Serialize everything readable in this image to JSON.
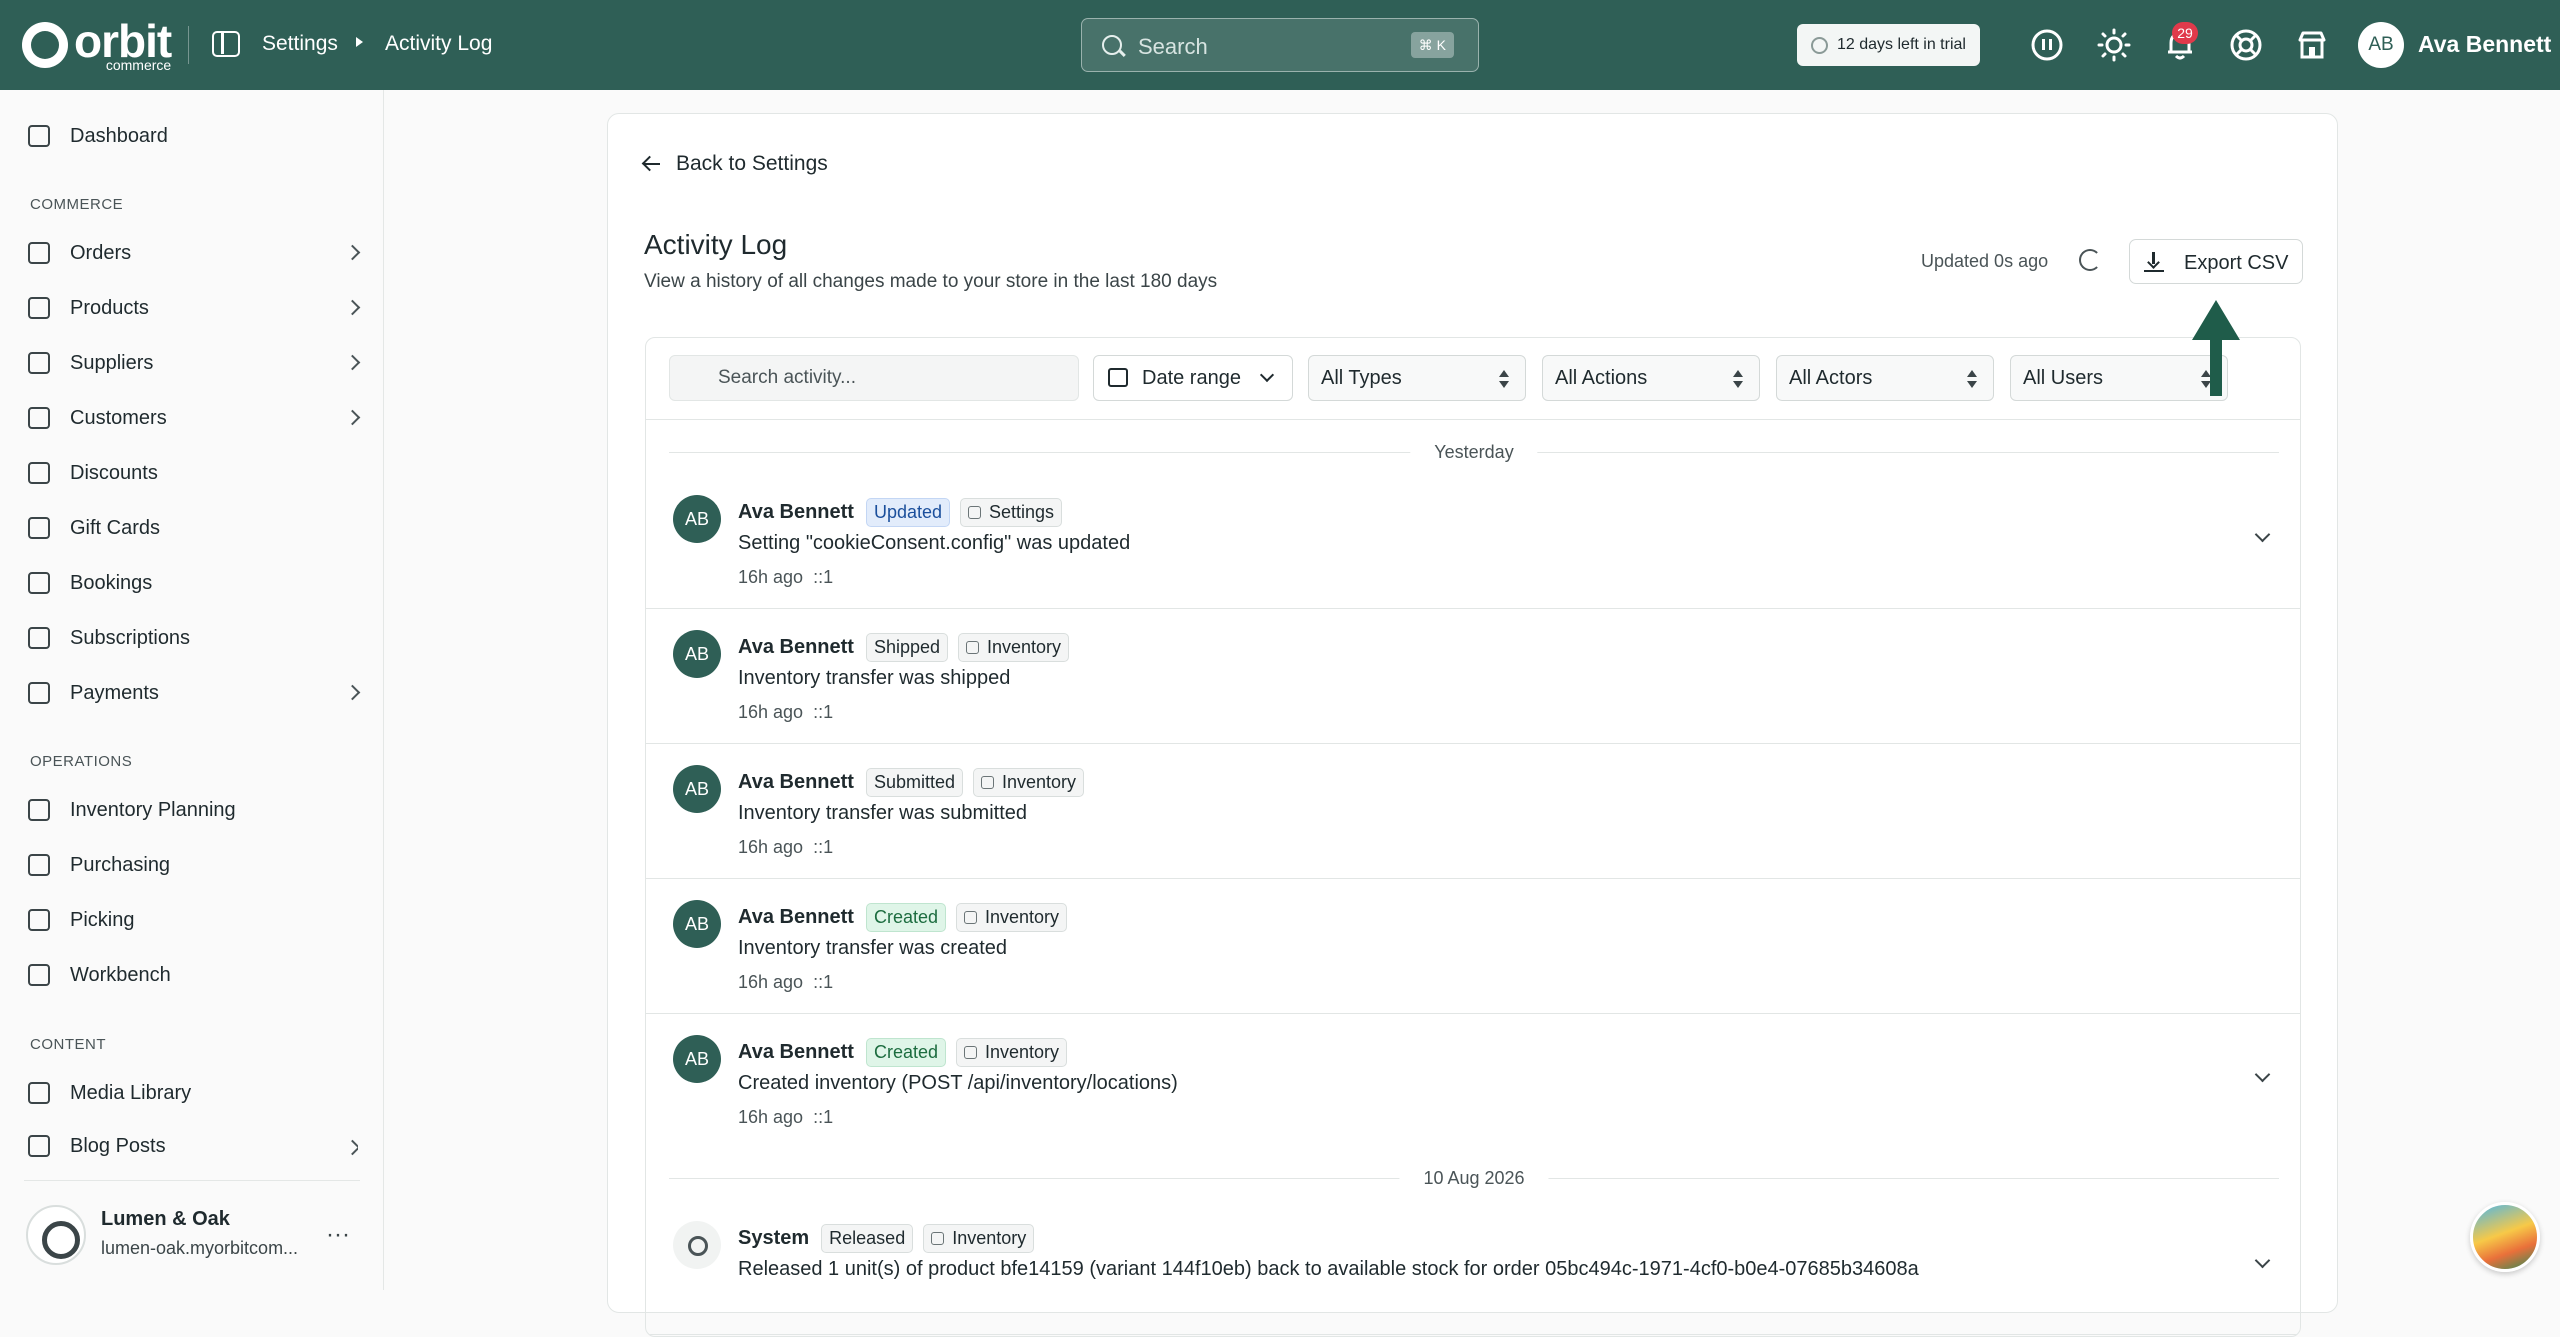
{
  "topbar": {
    "logo_main": "orbit",
    "logo_sub": "commerce",
    "breadcrumb": [
      "Settings",
      "Activity Log"
    ],
    "search_placeholder": "Search",
    "search_shortcut": "⌘ K",
    "trial_text": "12 days left in trial",
    "notification_count": "29",
    "user_initials": "AB",
    "user_name": "Ava Bennett"
  },
  "sidebar": {
    "dashboard": "Dashboard",
    "commerce_label": "COMMERCE",
    "commerce_items": [
      {
        "label": "Orders",
        "icon": "orders-icon",
        "has_children": true
      },
      {
        "label": "Products",
        "icon": "box-icon",
        "has_children": true
      },
      {
        "label": "Suppliers",
        "icon": "building-icon",
        "has_children": true
      },
      {
        "label": "Customers",
        "icon": "users-icon",
        "has_children": true
      },
      {
        "label": "Discounts",
        "icon": "tag-icon",
        "has_children": false
      },
      {
        "label": "Gift Cards",
        "icon": "gift-icon",
        "has_children": false
      },
      {
        "label": "Bookings",
        "icon": "calendar-icon",
        "has_children": false
      },
      {
        "label": "Subscriptions",
        "icon": "repeat-icon",
        "has_children": false
      },
      {
        "label": "Payments",
        "icon": "card-icon",
        "has_children": true
      }
    ],
    "operations_label": "OPERATIONS",
    "operations_items": [
      {
        "label": "Inventory Planning",
        "icon": "clipboard-icon"
      },
      {
        "label": "Purchasing",
        "icon": "cart-icon"
      },
      {
        "label": "Picking",
        "icon": "pin-icon"
      },
      {
        "label": "Workbench",
        "icon": "cube-icon"
      }
    ],
    "content_label": "CONTENT",
    "content_items": [
      {
        "label": "Media Library",
        "icon": "image-icon",
        "has_children": false
      },
      {
        "label": "Blog Posts",
        "icon": "doc-icon",
        "has_children": true
      }
    ],
    "store": {
      "name": "Lumen & Oak",
      "url": "lumen-oak.myorbitcom..."
    }
  },
  "main": {
    "back_label": "Back to Settings",
    "title": "Activity Log",
    "subtitle": "View a history of all changes made to your store in the last 180 days",
    "updated_text": "Updated 0s ago",
    "export_label": "Export CSV",
    "filters": {
      "search_placeholder": "Search activity...",
      "date_range": "Date range",
      "types": "All Types",
      "actions": "All Actions",
      "actors": "All Actors",
      "users": "All Users"
    },
    "groups": [
      {
        "date": "Yesterday",
        "entries": [
          {
            "actor": "Ava Bennett",
            "initials": "AB",
            "action": "Updated",
            "resource": "Settings",
            "message": "Setting \"cookieConsent.config\" was updated",
            "time": "16h ago",
            "ip": "::1",
            "expandable": true
          },
          {
            "actor": "Ava Bennett",
            "initials": "AB",
            "action": "Shipped",
            "resource": "Inventory",
            "message": "Inventory transfer was shipped",
            "time": "16h ago",
            "ip": "::1",
            "expandable": false
          },
          {
            "actor": "Ava Bennett",
            "initials": "AB",
            "action": "Submitted",
            "resource": "Inventory",
            "message": "Inventory transfer was submitted",
            "time": "16h ago",
            "ip": "::1",
            "expandable": false
          },
          {
            "actor": "Ava Bennett",
            "initials": "AB",
            "action": "Created",
            "resource": "Inventory",
            "message": "Inventory transfer was created",
            "time": "16h ago",
            "ip": "::1",
            "expandable": false
          },
          {
            "actor": "Ava Bennett",
            "initials": "AB",
            "action": "Created",
            "resource": "Inventory",
            "message": "Created inventory (POST /api/inventory/locations)",
            "time": "16h ago",
            "ip": "::1",
            "expandable": true
          }
        ]
      },
      {
        "date": "10 Aug 2026",
        "entries": [
          {
            "actor": "System",
            "initials": "",
            "action": "Released",
            "resource": "Inventory",
            "message": "Released 1 unit(s) of product bfe14159 (variant 144f10eb) back to available stock for order 05bc494c-1971-4cf0-b0e4-07685b34608a",
            "time": "",
            "ip": "",
            "expandable": true
          }
        ]
      }
    ]
  },
  "colors": {
    "brand": "#2f5f56",
    "badge": "#e03a4b",
    "annotation_arrow": "#1f5c4a"
  }
}
